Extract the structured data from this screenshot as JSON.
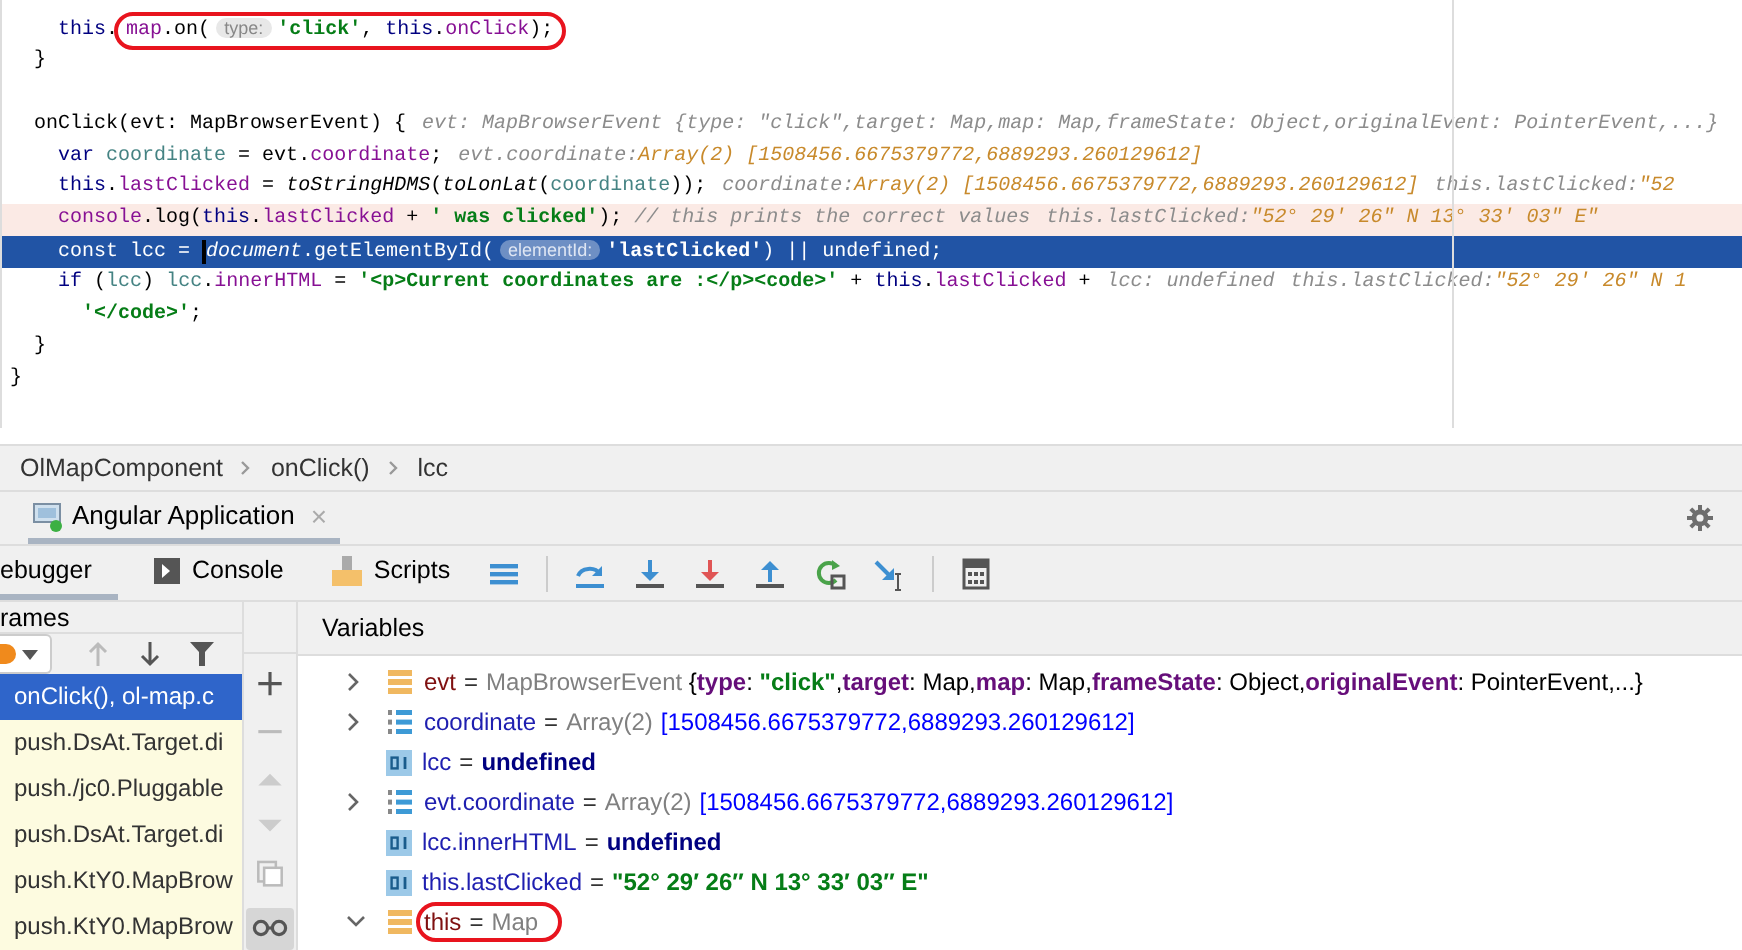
{
  "editor": {
    "lines": [
      {
        "kind": "plain",
        "tokens": [
          {
            "text": "    this",
            "kind": "kw"
          },
          {
            "text": ".",
            "kind": "plain"
          },
          {
            "kind": "circled",
            "tokens": [
              {
                "text": "map",
                "kind": "field"
              },
              {
                "text": ".on(",
                "kind": "plain"
              },
              {
                "text": "type:",
                "kind": "param"
              },
              {
                "text": "'click'",
                "kind": "str"
              },
              {
                "text": ", ",
                "kind": "plain"
              },
              {
                "text": "this",
                "kind": "kw"
              },
              {
                "text": ".",
                "kind": "plain"
              },
              {
                "text": "onClick",
                "kind": "field"
              },
              {
                "text": ");",
                "kind": "plain"
              }
            ]
          }
        ]
      },
      {
        "kind": "plain",
        "tokens": [
          {
            "text": "  }",
            "kind": "plain"
          }
        ]
      },
      {
        "kind": "plain"
      },
      {
        "kind": "plain",
        "tokens": [
          {
            "text": "  onClick(evt: MapBrowserEvent) {",
            "kind": "plain"
          },
          {
            "text": "evt: MapBrowserEvent {type: \"click\",target: Map,map: Map,frameState: Object,originalEvent: PointerEvent,...}",
            "kind": "hint"
          }
        ]
      },
      {
        "kind": "plain",
        "tokens": [
          {
            "text": "    var",
            "kind": "kw"
          },
          {
            "text": " coordinate",
            "kind": "local"
          },
          {
            "text": " =",
            "kind": "plain"
          },
          {
            "text": " evt",
            "kind": "plain"
          },
          {
            "text": ".",
            "kind": "plain"
          },
          {
            "text": "coordinate",
            "kind": "field"
          },
          {
            "text": ";",
            "kind": "plain"
          },
          {
            "text": "evt.coordinate:",
            "kind": "hint"
          },
          {
            "text": "Array(2) [1508456.6675379772,6889293.260129612]",
            "kind": "hintval"
          }
        ]
      },
      {
        "kind": "plain",
        "tokens": [
          {
            "text": "    this",
            "kind": "kw"
          },
          {
            "text": ".",
            "kind": "plain"
          },
          {
            "text": "lastClicked",
            "kind": "field"
          },
          {
            "text": " =",
            "kind": "plain"
          },
          {
            "text": " toStringHDMS",
            "kind": "ital"
          },
          {
            "text": "(",
            "kind": "plain"
          },
          {
            "text": "toLonLat",
            "kind": "ital"
          },
          {
            "text": "(",
            "kind": "plain"
          },
          {
            "text": "coordinate",
            "kind": "local"
          },
          {
            "text": "));",
            "kind": "plain"
          },
          {
            "text": "coordinate:",
            "kind": "hint"
          },
          {
            "text": "Array(2) [1508456.6675379772,6889293.260129612]",
            "kind": "hintval"
          },
          {
            "text": "this.lastClicked:",
            "kind": "hint"
          },
          {
            "text": "\"52",
            "kind": "hintval"
          }
        ]
      },
      {
        "kind": "visited",
        "tokens": [
          {
            "text": "    console",
            "kind": "field"
          },
          {
            "text": ".log(",
            "kind": "plain"
          },
          {
            "text": "this",
            "kind": "kw"
          },
          {
            "text": ".",
            "kind": "plain"
          },
          {
            "text": "lastClicked",
            "kind": "field"
          },
          {
            "text": " +",
            "kind": "plain"
          },
          {
            "text": " ' was clicked'",
            "kind": "str"
          },
          {
            "text": ");",
            "kind": "plain"
          },
          {
            "text": " // this prints the correct values",
            "kind": "comment"
          },
          {
            "text": "this.lastClicked:",
            "kind": "hint"
          },
          {
            "text": "\"52° 29′ 26″ N 13° 33′ 03″ E\"",
            "kind": "hintval"
          }
        ]
      },
      {
        "kind": "current",
        "tokens": [
          {
            "text": "    const lcc = ",
            "kind": "plain"
          },
          {
            "text": "document",
            "kind": "ital",
            "caret": true
          },
          {
            "text": ".getElementById(",
            "kind": "plain"
          },
          {
            "text": "elementId:",
            "kind": "param"
          },
          {
            "text": "'lastClicked'",
            "kind": "str"
          },
          {
            "text": ") || undefined;",
            "kind": "plain"
          }
        ]
      },
      {
        "kind": "plain",
        "tokens": [
          {
            "text": "    if",
            "kind": "kw"
          },
          {
            "text": " (",
            "kind": "plain"
          },
          {
            "text": "lcc",
            "kind": "local"
          },
          {
            "text": ")",
            "kind": "plain"
          },
          {
            "text": " lcc",
            "kind": "local"
          },
          {
            "text": ".",
            "kind": "plain"
          },
          {
            "text": "innerHTML",
            "kind": "field"
          },
          {
            "text": " =",
            "kind": "plain"
          },
          {
            "text": " '<p>Current coordinates are :</p><code>'",
            "kind": "str"
          },
          {
            "text": " +",
            "kind": "plain"
          },
          {
            "text": " this",
            "kind": "kw"
          },
          {
            "text": ".",
            "kind": "plain"
          },
          {
            "text": "lastClicked",
            "kind": "field"
          },
          {
            "text": " +",
            "kind": "plain"
          },
          {
            "text": "lcc: undefined",
            "kind": "hint"
          },
          {
            "text": "this.lastClicked:",
            "kind": "hint"
          },
          {
            "text": "\"52° 29′ 26″ N 1",
            "kind": "hintval"
          }
        ]
      },
      {
        "kind": "plain",
        "tokens": [
          {
            "text": "      '</code>'",
            "kind": "str"
          },
          {
            "text": ";",
            "kind": "plain"
          }
        ]
      },
      {
        "kind": "plain",
        "tokens": [
          {
            "text": "  }",
            "kind": "plain"
          }
        ]
      },
      {
        "kind": "plain",
        "tokens": [
          {
            "text": "}",
            "kind": "plain"
          }
        ]
      }
    ]
  },
  "breadcrumbs": [
    "OlMapComponent",
    "onClick()",
    "lcc"
  ],
  "run_tab": {
    "label": "Angular Application",
    "close": "×"
  },
  "debug_tabs": [
    {
      "label": "ebugger",
      "selected": true
    },
    {
      "label": "Console",
      "selected": false,
      "kind": "console"
    },
    {
      "label": "Scripts",
      "selected": false,
      "kind": "scripts"
    }
  ],
  "debug_actions": [
    {
      "kind": "layout"
    },
    {
      "kind": "step-over"
    },
    {
      "kind": "step-into"
    },
    {
      "kind": "force-step-into"
    },
    {
      "kind": "step-out"
    },
    {
      "kind": "restart-frame"
    },
    {
      "kind": "run-to-cursor"
    },
    {
      "kind": "evaluate"
    }
  ],
  "frames": {
    "title": "rames",
    "items": [
      {
        "label": "onClick(), ol-map.c",
        "selected": true
      },
      {
        "label": "push.DsAt.Target.di",
        "selected": false
      },
      {
        "label": "push./jc0.Pluggable",
        "selected": false
      },
      {
        "label": "push.DsAt.Target.di",
        "selected": false
      },
      {
        "label": "push.KtY0.MapBrow",
        "selected": false
      },
      {
        "label": "push.KtY0.MapBrow",
        "selected": false
      }
    ]
  },
  "variables": {
    "title": "Variables",
    "items": [
      {
        "kind": "object",
        "expandable": true,
        "expanded": false,
        "name": "evt",
        "value": [
          {
            "text": "=",
            "kind": "eq"
          },
          {
            "text": "MapBrowserEvent",
            "kind": "type"
          },
          {
            "text": " {",
            "kind": "plain"
          },
          {
            "text": "type",
            "kind": "key"
          },
          {
            "text": ": ",
            "kind": "plain"
          },
          {
            "text": "\"click\"",
            "kind": "str"
          },
          {
            "text": ",",
            "kind": "plain"
          },
          {
            "text": "target",
            "kind": "key"
          },
          {
            "text": ": Map,",
            "kind": "plain"
          },
          {
            "text": "map",
            "kind": "key"
          },
          {
            "text": ": Map,",
            "kind": "plain"
          },
          {
            "text": "frameState",
            "kind": "key"
          },
          {
            "text": ": Object,",
            "kind": "plain"
          },
          {
            "text": "originalEvent",
            "kind": "key"
          },
          {
            "text": ": PointerEvent,...}",
            "kind": "plain"
          }
        ]
      },
      {
        "kind": "array",
        "expandable": true,
        "expanded": false,
        "name": "coordinate",
        "value": [
          {
            "text": "=",
            "kind": "eq"
          },
          {
            "text": "Array(2)",
            "kind": "type"
          },
          {
            "text": "[1508456.6675379772,6889293.260129612]",
            "kind": "num"
          }
        ]
      },
      {
        "kind": "primitive",
        "expandable": false,
        "name": "lcc",
        "value": [
          {
            "text": "=",
            "kind": "eq"
          },
          {
            "text": "undefined",
            "kind": "kw"
          }
        ]
      },
      {
        "kind": "array",
        "expandable": true,
        "expanded": false,
        "name": "evt.coordinate",
        "value": [
          {
            "text": "=",
            "kind": "eq"
          },
          {
            "text": "Array(2)",
            "kind": "type"
          },
          {
            "text": "[1508456.6675379772,6889293.260129612]",
            "kind": "num"
          }
        ]
      },
      {
        "kind": "primitive",
        "expandable": false,
        "name": "lcc.innerHTML",
        "value": [
          {
            "text": "=",
            "kind": "eq"
          },
          {
            "text": "undefined",
            "kind": "kw"
          }
        ]
      },
      {
        "kind": "primitive",
        "expandable": false,
        "name": "this.lastClicked",
        "value": [
          {
            "text": "=",
            "kind": "eq"
          },
          {
            "text": "\"52° 29′ 26″ N 13° 33′ 03″ E\"",
            "kind": "str"
          }
        ]
      },
      {
        "kind": "object",
        "expandable": true,
        "expanded": true,
        "name": "this",
        "circled": true,
        "value": [
          {
            "text": "=",
            "kind": "eq"
          },
          {
            "text": "Map",
            "kind": "type"
          }
        ]
      }
    ]
  }
}
